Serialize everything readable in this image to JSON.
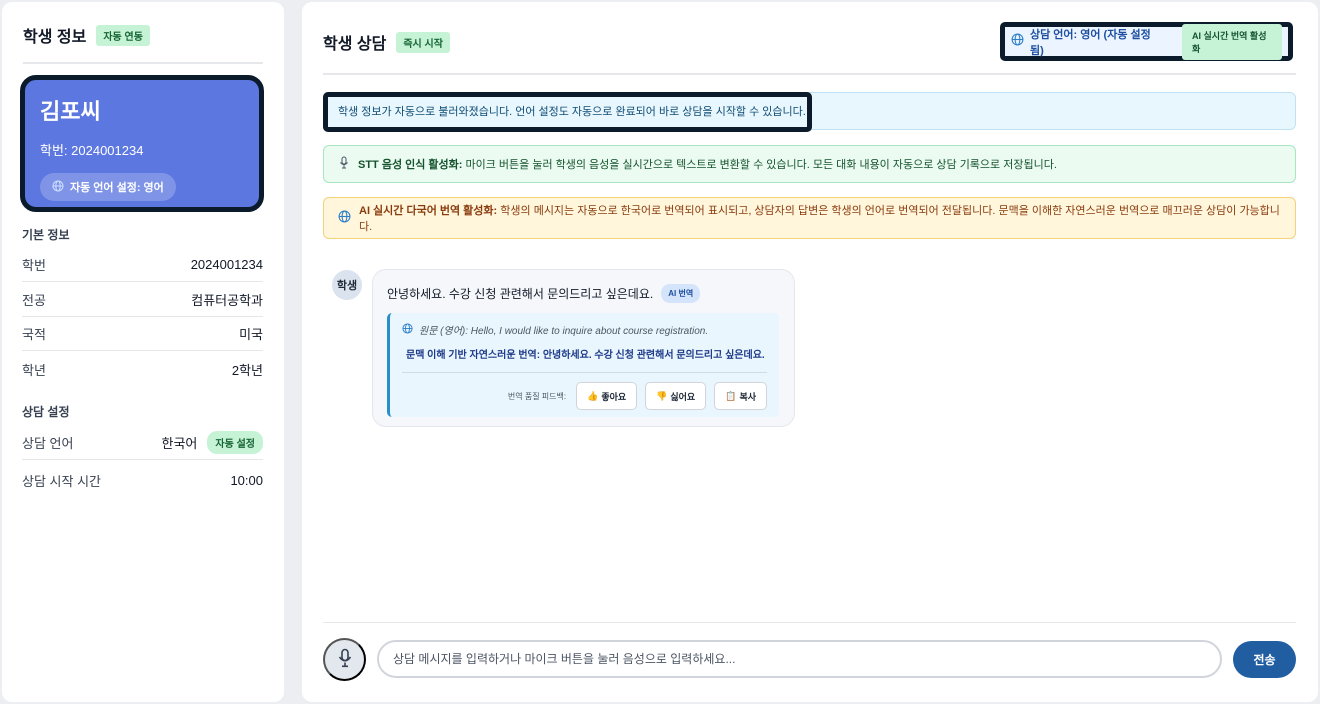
{
  "left": {
    "title": "학생 정보",
    "title_badge": "자동 연동",
    "student": {
      "name": "김포씨",
      "id_line": "학번: 2024001234",
      "lang_chip": "자동 언어 설정: 영어"
    },
    "basic_section": "기본 정보",
    "basic_rows": [
      {
        "key": "학번",
        "value": "2024001234"
      },
      {
        "key": "전공",
        "value": "컴퓨터공학과"
      },
      {
        "key": "국적",
        "value": "미국"
      },
      {
        "key": "학년",
        "value": "2학년"
      }
    ],
    "consult_section": "상담 설정",
    "consult_rows": [
      {
        "key": "상담 언어",
        "value": "한국어",
        "badge": "자동 설정"
      },
      {
        "key": "상담 시작 시간",
        "value": "10:00"
      }
    ]
  },
  "main": {
    "title": "학생 상담",
    "title_badge": "즉시 시작",
    "lang_status": "상담 언어: 영어 (자동 설정됨)",
    "ai_badge": "AI 실시간 번역 활성화",
    "notices": {
      "info": "학생 정보가 자동으로 불러와졌습니다. 언어 설정도 자동으로 완료되어 바로 상담을 시작할 수 있습니다.",
      "stt_title": "STT 음성 인식 활성화:",
      "stt_text": "마이크 버튼을 눌러 학생의 음성을 실시간으로 텍스트로 변환할 수 있습니다. 모든 대화 내용이 자동으로 상담 기록으로 저장됩니다.",
      "ai_title": "AI 실시간 다국어 번역 활성화:",
      "ai_text": "학생의 메시지는 자동으로 한국어로 번역되어 표시되고, 상담자의 답변은 학생의 언어로 번역되어 전달됩니다. 문맥을 이해한 자연스러운 번역으로 매끄러운 상담이 가능합니다."
    },
    "message": {
      "avatar": "학생",
      "text": "안녕하세요. 수강 신청 관련해서 문의드리고 싶은데요.",
      "tag": "AI 번역",
      "original": "원문 (영어): Hello, I would like to inquire about course registration.",
      "natural": "문맥 이해 기반 자연스러운 번역: 안녕하세요. 수강 신청 관련해서 문의드리고 싶은데요.",
      "feedback_label": "번역 품질 피드백:",
      "like": "좋아요",
      "dislike": "싫어요",
      "copy": "복사"
    },
    "composer": {
      "placeholder": "상담 메시지를 입력하거나 마이크 버튼을 눌러 음성으로 입력하세요...",
      "send": "전송"
    }
  }
}
